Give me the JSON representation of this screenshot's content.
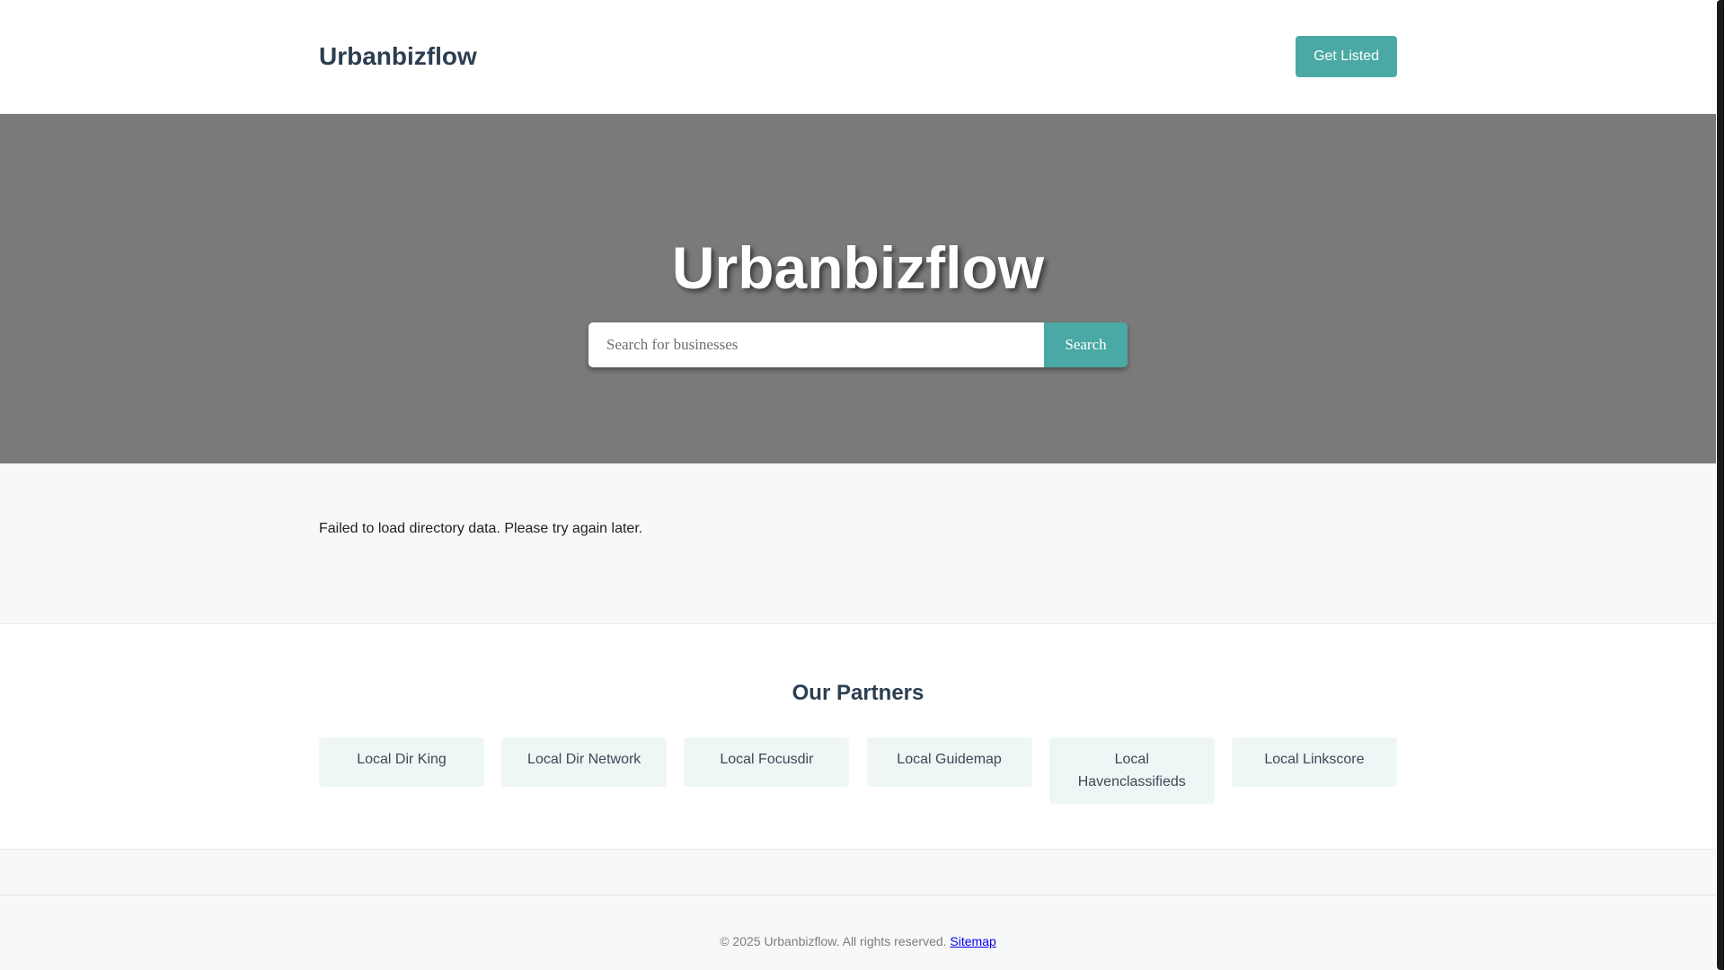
{
  "header": {
    "logo": "Urbanbizflow",
    "cta_label": "Get Listed"
  },
  "hero": {
    "title": "Urbanbizflow",
    "search_placeholder": "Search for businesses",
    "search_button_label": "Search"
  },
  "directory": {
    "error_message": "Failed to load directory data. Please try again later."
  },
  "partners": {
    "title": "Our Partners",
    "items": [
      {
        "label": "Local Dir King"
      },
      {
        "label": "Local Dir Network"
      },
      {
        "label": "Local Focusdir"
      },
      {
        "label": "Local Guidemap"
      },
      {
        "label": "Local Havenclassifieds"
      },
      {
        "label": "Local Linkscore"
      }
    ]
  },
  "footer": {
    "copyright": "© 2025 Urbanbizflow. All rights reserved.",
    "sitemap_label": "Sitemap"
  },
  "colors": {
    "accent": "#4aa9a4",
    "hero_background": "#7a7a7a",
    "heading": "#2c3e50",
    "partner_card": "#eff6f6"
  }
}
